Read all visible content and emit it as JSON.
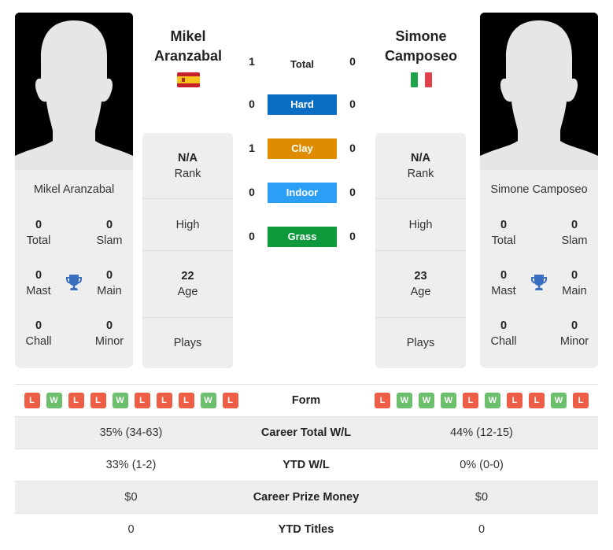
{
  "players": {
    "left": {
      "name": "Mikel Aranzabal",
      "first_name": "Mikel",
      "last_name": "Aranzabal",
      "country_flag": "spain-flag",
      "titles": {
        "total": {
          "value": "0",
          "label": "Total"
        },
        "slam": {
          "value": "0",
          "label": "Slam"
        },
        "mast": {
          "value": "0",
          "label": "Mast"
        },
        "main": {
          "value": "0",
          "label": "Main"
        },
        "chall": {
          "value": "0",
          "label": "Chall"
        },
        "minor": {
          "value": "0",
          "label": "Minor"
        }
      },
      "info": {
        "rank": {
          "value": "N/A",
          "label": "Rank"
        },
        "high": {
          "label": "High"
        },
        "age": {
          "value": "22",
          "label": "Age"
        },
        "plays": {
          "label": "Plays"
        }
      },
      "form": [
        "L",
        "W",
        "L",
        "L",
        "W",
        "L",
        "L",
        "L",
        "W",
        "L"
      ]
    },
    "right": {
      "name": "Simone Camposeo",
      "first_name": "Simone",
      "last_name": "Camposeo",
      "country_flag": "italy-flag",
      "titles": {
        "total": {
          "value": "0",
          "label": "Total"
        },
        "slam": {
          "value": "0",
          "label": "Slam"
        },
        "mast": {
          "value": "0",
          "label": "Mast"
        },
        "main": {
          "value": "0",
          "label": "Main"
        },
        "chall": {
          "value": "0",
          "label": "Chall"
        },
        "minor": {
          "value": "0",
          "label": "Minor"
        }
      },
      "info": {
        "rank": {
          "value": "N/A",
          "label": "Rank"
        },
        "high": {
          "label": "High"
        },
        "age": {
          "value": "23",
          "label": "Age"
        },
        "plays": {
          "label": "Plays"
        }
      },
      "form": [
        "L",
        "W",
        "W",
        "W",
        "L",
        "W",
        "L",
        "L",
        "W",
        "L"
      ]
    }
  },
  "h2h": [
    {
      "label": "Total",
      "left": "1",
      "right": "0",
      "color": ""
    },
    {
      "label": "Hard",
      "left": "0",
      "right": "0",
      "color": "#0a6ec5"
    },
    {
      "label": "Clay",
      "left": "1",
      "right": "0",
      "color": "#e08c00"
    },
    {
      "label": "Indoor",
      "left": "0",
      "right": "0",
      "color": "#2b9ef5"
    },
    {
      "label": "Grass",
      "left": "0",
      "right": "0",
      "color": "#0e9a3c"
    }
  ],
  "comparison": {
    "form_label": "Form",
    "rows": [
      {
        "label": "Career Total W/L",
        "left": "35% (34-63)",
        "right": "44% (12-15)"
      },
      {
        "label": "YTD W/L",
        "left": "33% (1-2)",
        "right": "0% (0-0)"
      },
      {
        "label": "Career Prize Money",
        "left": "$0",
        "right": "$0"
      },
      {
        "label": "YTD Titles",
        "left": "0",
        "right": "0"
      }
    ]
  },
  "colors": {
    "loss": "#ee5e47",
    "win": "#6cbf6c",
    "trophy": "#3a6fc0",
    "card_bg": "#eeeeee"
  }
}
